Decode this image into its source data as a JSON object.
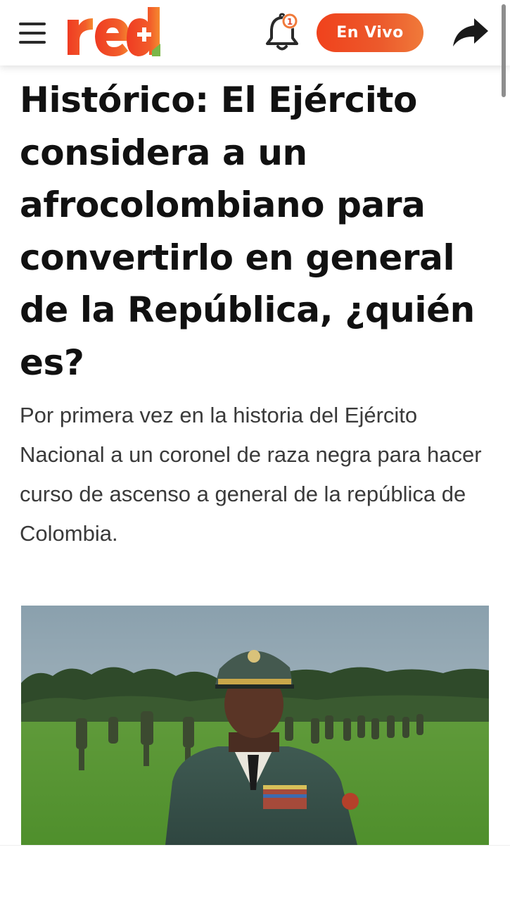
{
  "header": {
    "logo_text": "red+",
    "live_button_label": "En Vivo",
    "bell_badge": "1"
  },
  "article": {
    "headline": "Histórico: El Ejército considera a un afrocolombiano para convertirlo en general de la República, ¿quién es?",
    "lead": "Por primera vez en la historia del Ejército Nacional a un coronel de raza negra para hacer curso de ascenso a general de la república de Colombia."
  },
  "icons": {
    "menu": "hamburger-menu-icon",
    "bell": "bell-icon",
    "share": "share-arrow-icon"
  },
  "colors": {
    "brand_orange": "#ec5a2c",
    "logo_green": "#7ab648",
    "text_dark": "#111111",
    "text_body": "#3a3a3a"
  }
}
